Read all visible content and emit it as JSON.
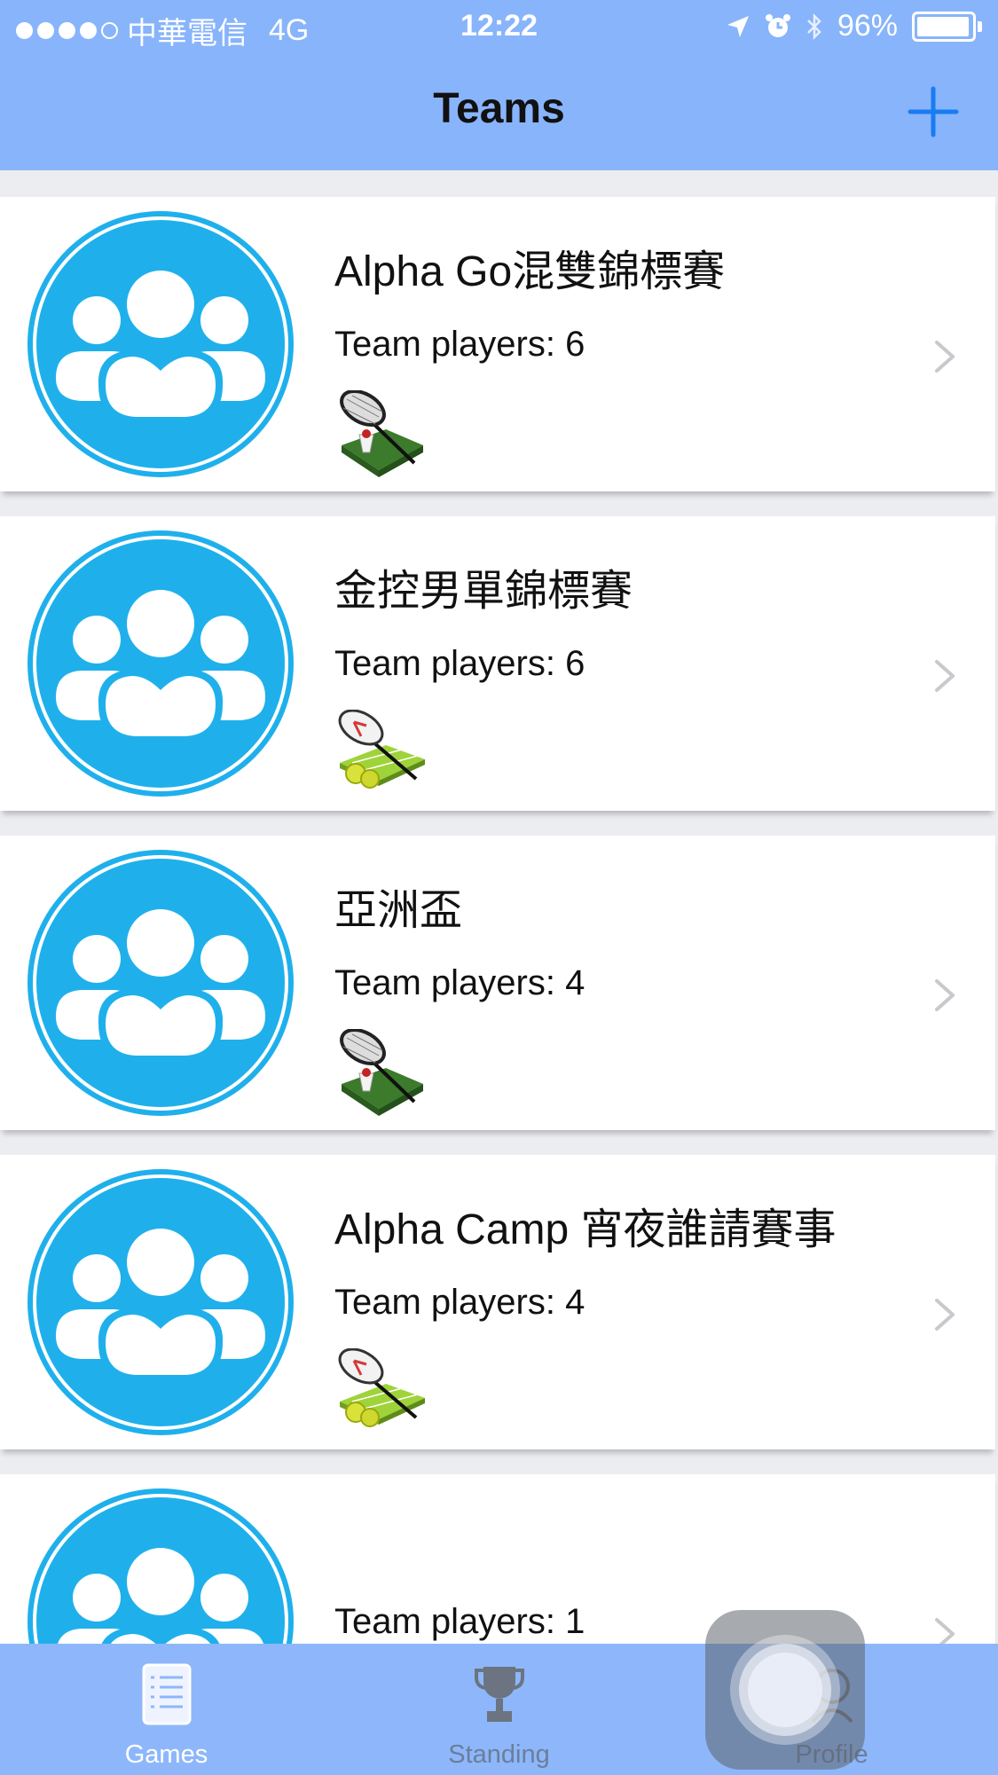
{
  "status_bar": {
    "carrier": "中華電信",
    "network": "4G",
    "time": "12:22",
    "battery": "96%"
  },
  "nav": {
    "title": "Teams"
  },
  "teams": [
    {
      "name": "Alpha Go混雙錦標賽",
      "players": "Team players: 6",
      "sport_icon": "badminton-icon"
    },
    {
      "name": "金控男單錦標賽",
      "players": "Team players: 6",
      "sport_icon": "tennis-icon"
    },
    {
      "name": "亞洲盃",
      "players": "Team players: 4",
      "sport_icon": "badminton-icon"
    },
    {
      "name": "Alpha Camp 宵夜誰請賽事",
      "players": "Team players: 4",
      "sport_icon": "tennis-icon"
    },
    {
      "name": "",
      "players": "Team players: 1",
      "sport_icon": ""
    }
  ],
  "tab_bar": {
    "tabs": [
      {
        "label": "Games",
        "icon": "list-icon",
        "active": true
      },
      {
        "label": "Standing",
        "icon": "trophy-icon",
        "active": false
      },
      {
        "label": "Profile",
        "icon": "profile-icon",
        "active": false
      }
    ]
  },
  "colors": {
    "nav_background": "#88b4fb",
    "tab_background": "#8db7fa",
    "avatar_blue": "#1fb0ec",
    "accent": "#1a7cf2"
  }
}
